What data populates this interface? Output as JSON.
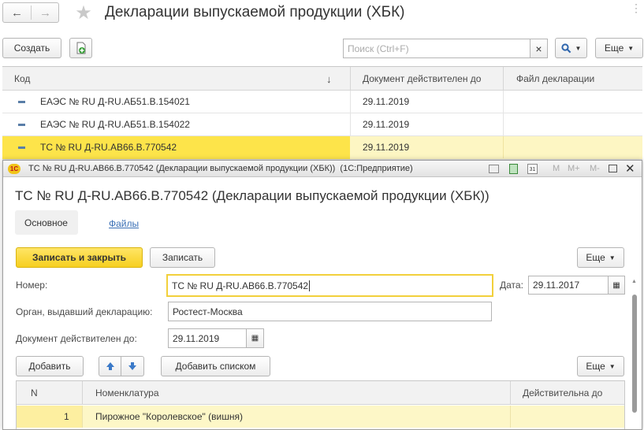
{
  "window": {
    "title": "Декларации выпускаемой продукции (ХБК)"
  },
  "nav": {
    "back_icon": "←",
    "forward_icon": "→",
    "star_icon": "★"
  },
  "list_toolbar": {
    "create_label": "Создать",
    "search_placeholder": "Поиск (Ctrl+F)",
    "clear_glyph": "×",
    "more_label": "Еще"
  },
  "list_table": {
    "columns": [
      "Код",
      "Документ действителен до",
      "Файл декларации"
    ],
    "sort_icon": "↓",
    "rows": [
      {
        "code": "ЕАЭС № RU Д-RU.АБ51.В.154021",
        "valid_to": "29.11.2019",
        "file": ""
      },
      {
        "code": "ЕАЭС № RU Д-RU.АБ51.В.154022",
        "valid_to": "29.11.2019",
        "file": ""
      },
      {
        "code": "ТС № RU Д-RU.АВ66.В.770542",
        "valid_to": "29.11.2019",
        "file": ""
      }
    ]
  },
  "dialog": {
    "titlebar": "ТС № RU Д-RU.АВ66.В.770542 (Декларации выпускаемой продукции (ХБК))  (1С:Предприятие)",
    "app_badge": "1С",
    "tb_buttons": [
      "M",
      "M+",
      "M-"
    ],
    "heading": "ТС № RU Д-RU.АВ66.В.770542 (Декларации выпускаемой продукции (ХБК))",
    "tabs": [
      "Основное",
      "Файлы"
    ],
    "save_close_label": "Записать и закрыть",
    "save_label": "Записать",
    "more_label": "Еще",
    "fields": {
      "number_label": "Номер:",
      "number_value": "ТС № RU Д-RU.АВ66.В.770542",
      "date_label": "Дата:",
      "date_value": "29.11.2017",
      "organ_label": "Орган, выдавший декларацию:",
      "organ_value": "Ростест-Москва",
      "valid_label": "Документ действителен до:",
      "valid_value": "29.11.2019"
    },
    "items_toolbar": {
      "add_label": "Добавить",
      "add_list_label": "Добавить списком",
      "more_label": "Еще"
    },
    "items_table": {
      "columns": [
        "N",
        "Номенклатура",
        "Действительна до"
      ],
      "rows": [
        {
          "n": "1",
          "item": "Пирожное \"Королевское\" (вишня)",
          "valid_to": ""
        }
      ]
    }
  },
  "colors": {
    "selection": "#fde44a",
    "item_row": "#fdf7c7",
    "accent_blue": "#3a79c8",
    "primary_button": "#f6cf1f"
  }
}
